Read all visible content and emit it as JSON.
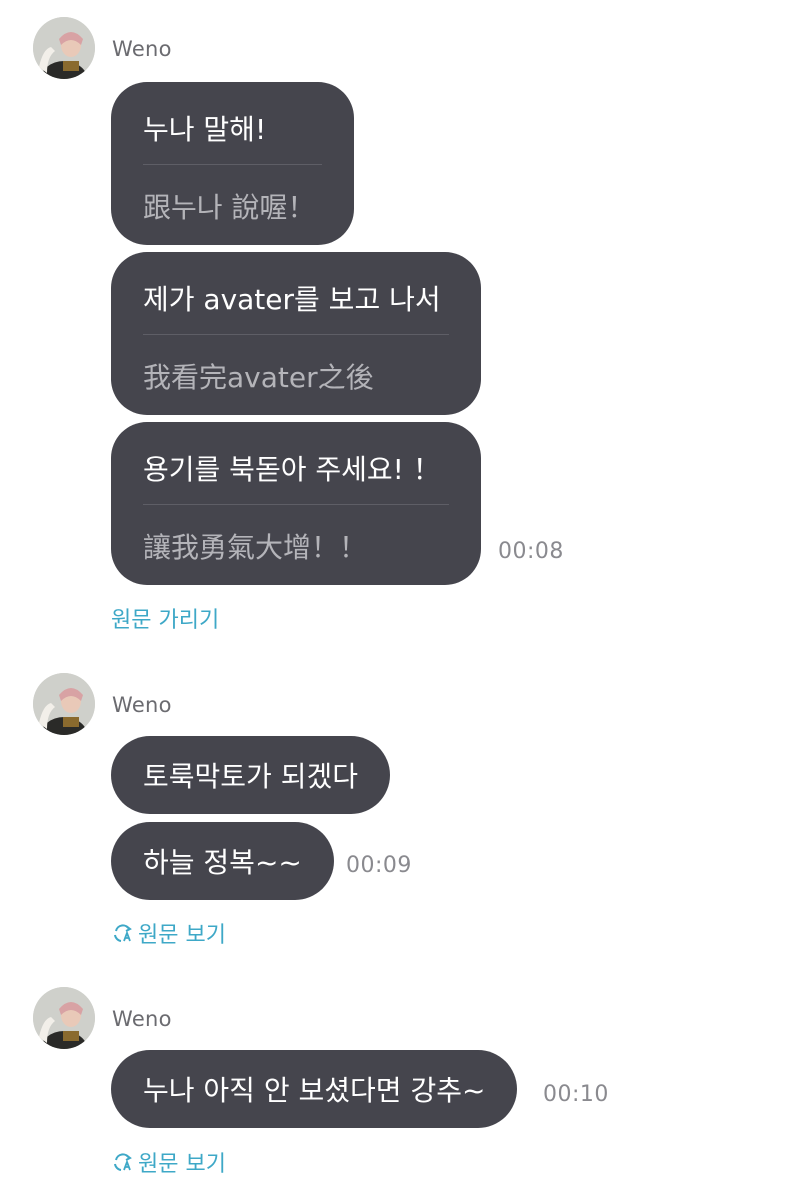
{
  "groups": [
    {
      "sender": "Weno",
      "messages": [
        {
          "original": "누나 말해!",
          "translation": "跟누나 說喔！"
        },
        {
          "original": "제가 avater를 보고 나서",
          "translation": "我看完avater之後"
        },
        {
          "original": "용기를 북돋아 주세요! ！",
          "translation": "讓我勇氣大增！！"
        }
      ],
      "time": "00:08",
      "link_label": "원문 가리기"
    },
    {
      "sender": "Weno",
      "messages": [
        {
          "original": "토룩막토가 되겠다"
        },
        {
          "original": "하늘 정복~~"
        }
      ],
      "time": "00:09",
      "link_label": "원문 보기",
      "link_icon": "translate-refresh-icon"
    },
    {
      "sender": "Weno",
      "messages": [
        {
          "original": "누나 아직 안 보셨다면 강추~"
        }
      ],
      "time": "00:10",
      "link_label": "원문 보기",
      "link_icon": "translate-refresh-icon"
    }
  ],
  "colors": {
    "bubble": "#45454d",
    "link": "#3ea8c7",
    "timestamp": "#8a8a8f",
    "sender": "#6b6b70"
  }
}
